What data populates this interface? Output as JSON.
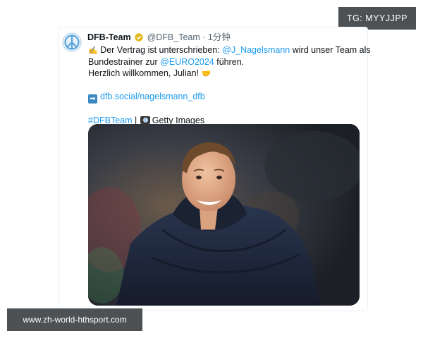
{
  "watermark_top": "TG: MYYJJPP",
  "watermark_bottom": "www.zh-world-hthsport.com",
  "tweet": {
    "author_name": "DFB-Team",
    "handle": "@DFB_Team",
    "separator": "·",
    "time": "1分钟",
    "line1_text": " Der Vertrag ist unterschrieben: ",
    "line1_mention": "@J_Nagelsmann",
    "line1_rest": " wird unser Team als",
    "line2_text": "Bundestrainer zur ",
    "line2_mention": "@EURO2024",
    "line2_rest": " führen.",
    "line3_text": "Herzlich willkommen, Julian! ",
    "link": "dfb.social/nagelsmann_dfb",
    "hashtag": "#DFBTeam",
    "pipe": "|",
    "credit": "Getty Images"
  },
  "icons": {
    "avatar": "peace-logo-icon",
    "verified": "verified-badge-icon",
    "writing_hand": "writing-hand-emoji",
    "handshake": "handshake-emoji",
    "arrow": "right-arrow-emoji",
    "camera": "camera-emoji"
  },
  "colors": {
    "link": "#1d9bf0",
    "verified": "#e2b719",
    "watermark_bg": "#4d5154"
  }
}
